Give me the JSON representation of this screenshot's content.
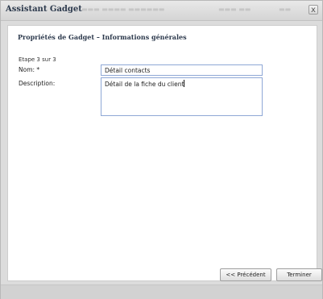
{
  "window": {
    "title": "Assistant Gadget",
    "close_label": "x"
  },
  "panel": {
    "section_title": "Propriétés de Gadget – Informations générales",
    "step": "Etape 3 sur 3"
  },
  "form": {
    "name_label": "Nom: *",
    "name_value": "Détail contacts",
    "description_label": "Description:",
    "description_value": "Détail de la fiche du client"
  },
  "buttons": {
    "previous_label": "<< Précédent",
    "finish_label": "Terminer"
  }
}
